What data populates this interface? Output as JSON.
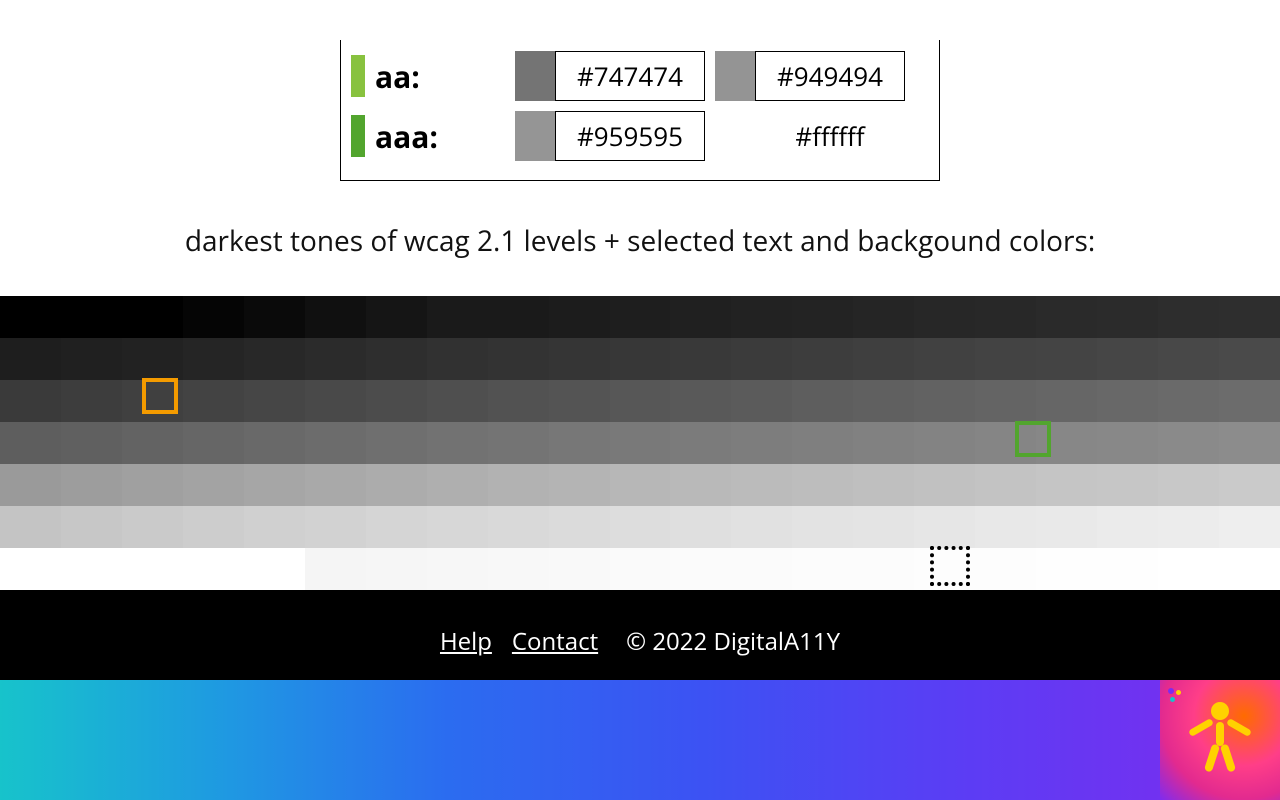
{
  "wcag": {
    "rows": [
      {
        "bar_color": "#88c23f",
        "label": "aa:",
        "samples": [
          {
            "swatch": "#747474",
            "hex": "#747474",
            "boxed": true
          },
          {
            "swatch": "#949494",
            "hex": "#949494",
            "boxed": true
          }
        ]
      },
      {
        "bar_color": "#52a52e",
        "label": "aaa:",
        "samples": [
          {
            "swatch": "#959595",
            "hex": "#959595",
            "boxed": true
          },
          {
            "swatch": null,
            "hex": "#ffffff",
            "boxed": false
          }
        ]
      }
    ]
  },
  "description": "darkest tones of wcag 2.1 levels + selected text and backgound colors:",
  "tone_rows": [
    [
      "#000000",
      "#000000",
      "#000000",
      "#050505",
      "#0a0a0a",
      "#101010",
      "#151515",
      "#1a1a1a",
      "#1a1a1a",
      "#1c1c1c",
      "#1e1e1e",
      "#202020",
      "#222222",
      "#232323",
      "#252525",
      "#272727",
      "#282828",
      "#2a2a2a",
      "#2b2b2b",
      "#2d2d2d",
      "#2e2e2e"
    ],
    [
      "#1e1e1e",
      "#202020",
      "#222222",
      "#252525",
      "#282828",
      "#2b2b2b",
      "#2e2e2e",
      "#313131",
      "#333333",
      "#353535",
      "#373737",
      "#393939",
      "#3b3b3b",
      "#3d3d3d",
      "#3f3f3f",
      "#414141",
      "#434343",
      "#444444",
      "#464646",
      "#484848",
      "#4a4a4a"
    ],
    [
      "#3a3a3a",
      "#3d3d3d",
      "#404040",
      "#434343",
      "#464646",
      "#494949",
      "#4c4c4c",
      "#4f4f4f",
      "#525252",
      "#545454",
      "#575757",
      "#595959",
      "#5b5b5b",
      "#5e5e5e",
      "#606060",
      "#626262",
      "#646464",
      "#666666",
      "#686868",
      "#6a6a6a",
      "#6c6c6c"
    ],
    [
      "#5e5e5e",
      "#606060",
      "#636363",
      "#666666",
      "#696969",
      "#6c6c6c",
      "#6f6f6f",
      "#727272",
      "#747474",
      "#777777",
      "#797979",
      "#7b7b7b",
      "#7d7d7d",
      "#7f7f7f",
      "#818181",
      "#838383",
      "#858585",
      "#878787",
      "#888888",
      "#8a8a8a",
      "#8c8c8c"
    ],
    [
      "#9a9a9a",
      "#9d9d9d",
      "#a0a0a0",
      "#a3a3a3",
      "#a6a6a6",
      "#a9a9a9",
      "#acacac",
      "#afafaf",
      "#b2b2b2",
      "#b4b4b4",
      "#b7b7b7",
      "#b9b9b9",
      "#bbbbbb",
      "#bdbdbd",
      "#bfbfbf",
      "#c1c1c1",
      "#c3c3c3",
      "#c5c5c5",
      "#c6c6c6",
      "#c8c8c8",
      "#cacaca"
    ],
    [
      "#c4c4c4",
      "#c7c7c7",
      "#cacaca",
      "#cdcdcd",
      "#d0d0d0",
      "#d2d2d2",
      "#d5d5d5",
      "#d7d7d7",
      "#d9d9d9",
      "#dbdbdb",
      "#dddddd",
      "#dfdfdf",
      "#e1e1e1",
      "#e3e3e3",
      "#e4e4e4",
      "#e6e6e6",
      "#e8e8e8",
      "#e9e9e9",
      "#ebebeb",
      "#ececec",
      "#eeeeee"
    ],
    [
      "#ffffff",
      "#ffffff",
      "#ffffff",
      "#ffffff",
      "#ffffff",
      "#f5f5f5",
      "#f6f6f6",
      "#f7f7f7",
      "#f8f8f8",
      "#f9f9f9",
      "#fafafa",
      "#fbfbfb",
      "#fbfbfb",
      "#fcfcfc",
      "#fcfcfc",
      "#fdfdfd",
      "#fdfdfd",
      "#fefefe",
      "#fefefe",
      "#ffffff",
      "#ffffff"
    ]
  ],
  "footer": {
    "help": "Help",
    "contact": "Contact",
    "copyright": "© 2022 DigitalA11Y"
  }
}
